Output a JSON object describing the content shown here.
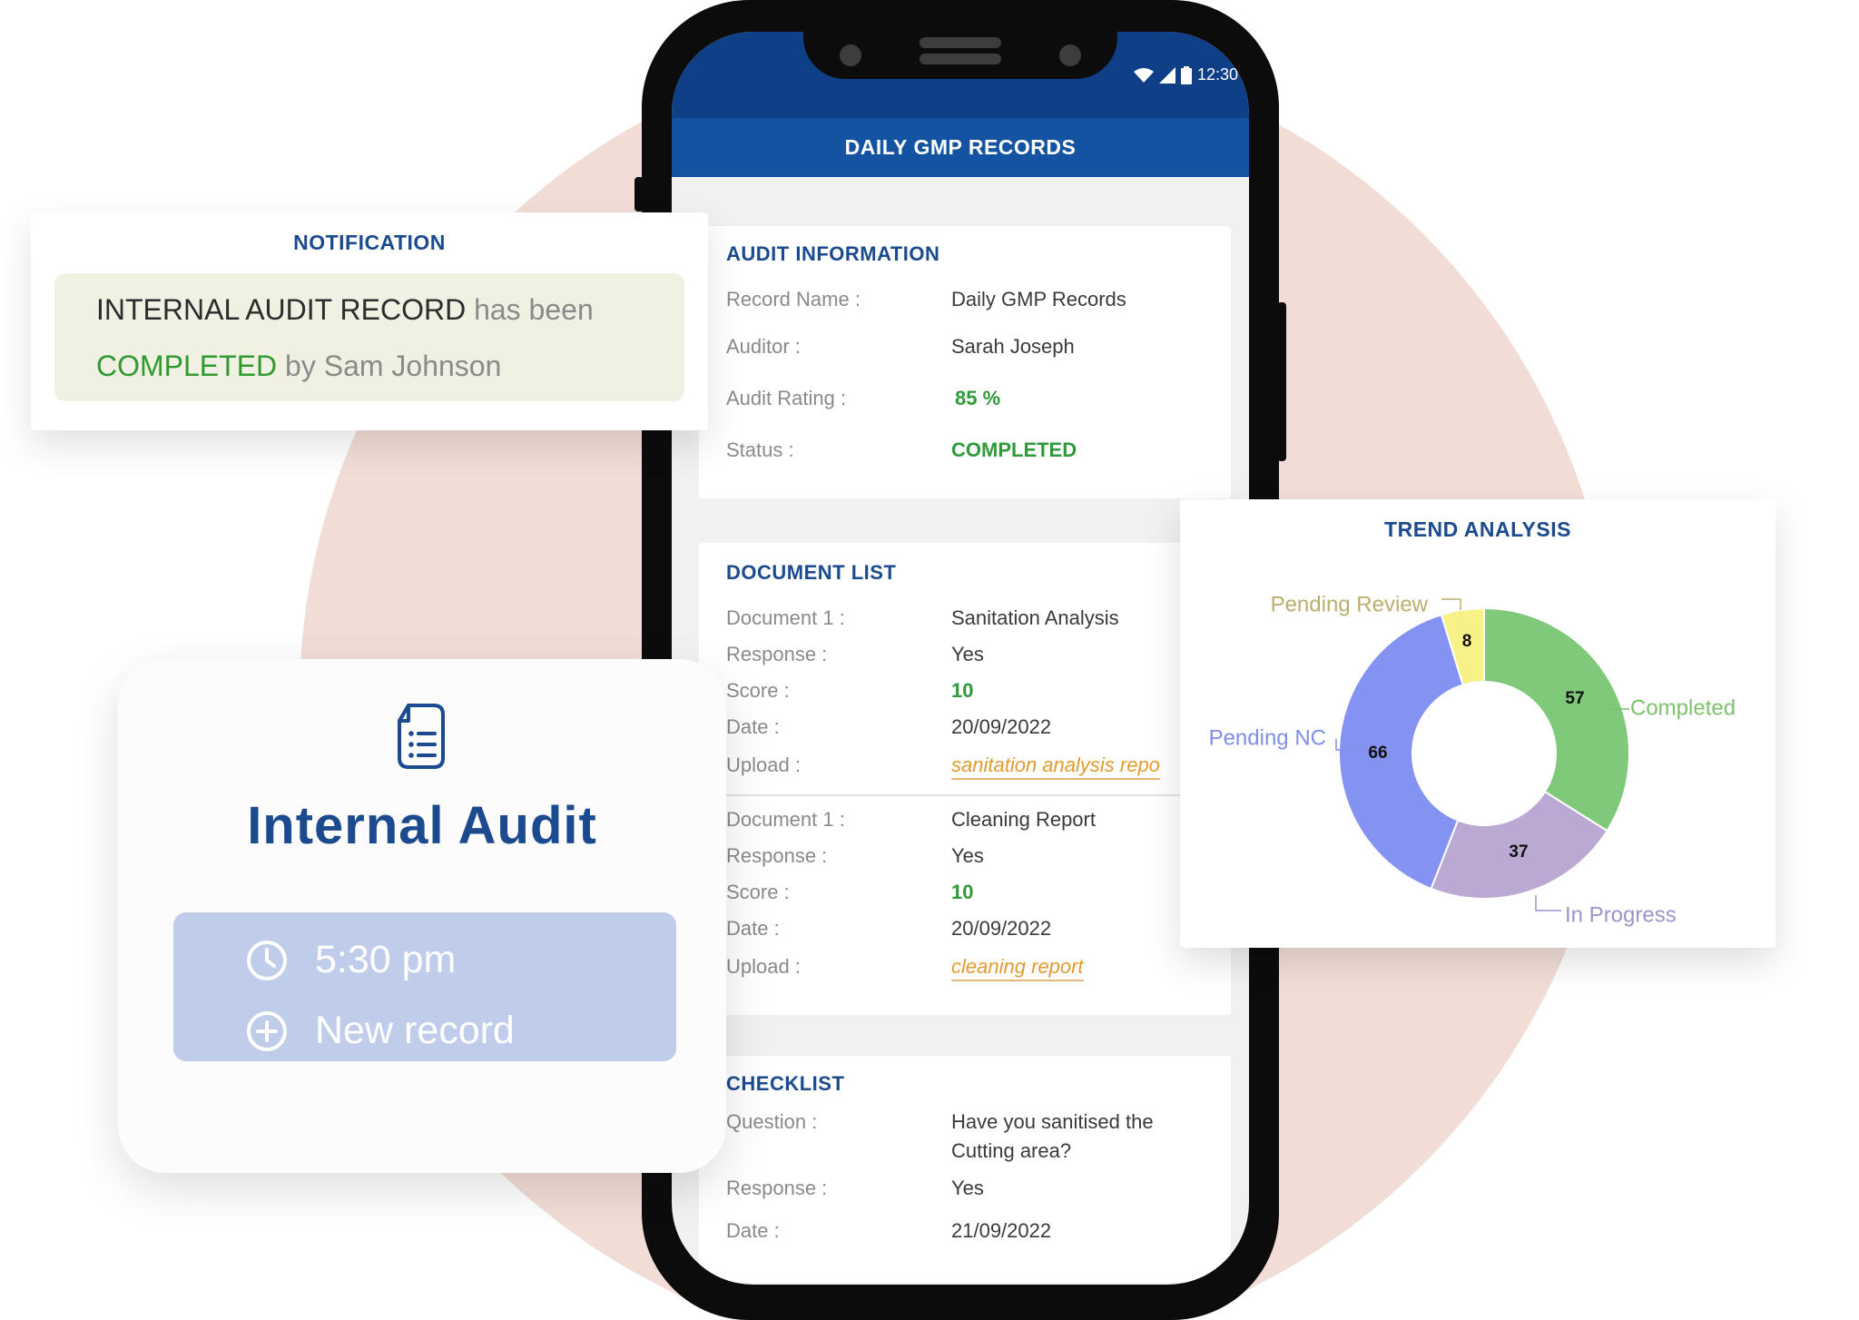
{
  "phone": {
    "time": "12:30",
    "app_title": "DAILY GMP RECORDS",
    "audit_info": {
      "title": "AUDIT INFORMATION",
      "rows": [
        {
          "label": "Record Name  :",
          "value": "Daily GMP Records"
        },
        {
          "label": "Auditor :",
          "value": "Sarah Joseph"
        },
        {
          "label": "Audit Rating :",
          "value": "85 %"
        },
        {
          "label": "Status :",
          "value": "COMPLETED"
        }
      ]
    },
    "document_list": {
      "title": "DOCUMENT LIST",
      "documents": [
        {
          "doc_label": "Document 1  :",
          "doc_value": "Sanitation Analysis",
          "response_label": "Response  :",
          "response_value": "Yes",
          "score_label": "Score :",
          "score_value": "10",
          "date_label": "Date :",
          "date_value": "20/09/2022",
          "upload_label": "Upload :",
          "upload_value": "sanitation analysis repo"
        },
        {
          "doc_label": "Document 1  :",
          "doc_value": "Cleaning Report",
          "response_label": "Response  :",
          "response_value": "Yes",
          "score_label": "Score :",
          "score_value": "10",
          "date_label": "Date :",
          "date_value": "20/09/2022",
          "upload_label": "Upload :",
          "upload_value": "cleaning report"
        }
      ]
    },
    "checklist": {
      "title": "CHECKLIST",
      "question_label": "Question :",
      "question_line1": "Have you sanitised the",
      "question_line2": "Cutting area?",
      "response_label": "Response  :",
      "response_value": "Yes",
      "date_label": "Date :",
      "date_value": "21/09/2022"
    }
  },
  "notification": {
    "title": "NOTIFICATION",
    "record": "INTERNAL AUDIT RECORD",
    "has_been": "has been",
    "status": "COMPLETED",
    "by": "by Sam Johnson"
  },
  "internal_audit": {
    "title": "Internal Audit",
    "time": "5:30 pm",
    "action": "New record"
  },
  "trend": {
    "title": "TREND ANALYSIS"
  },
  "chart_data": {
    "type": "pie",
    "donut": true,
    "title": "TREND ANALYSIS",
    "categories": [
      "Completed",
      "In Progress",
      "Pending NC",
      "Pending Review"
    ],
    "values": [
      57,
      37,
      66,
      8
    ],
    "colors": [
      "#80c97a",
      "#bba8d3",
      "#8492f2",
      "#f7f287"
    ],
    "label_colors": [
      "#7cc26e",
      "#9e94c9",
      "#7f8fe6",
      "#b9ae6e"
    ]
  },
  "colors": {
    "navy": "#1b4a8f",
    "app_bar": "#1453a1",
    "green": "#2f9a3a",
    "link": "#e39b2f",
    "bg_circle": "#f2ddd6"
  }
}
